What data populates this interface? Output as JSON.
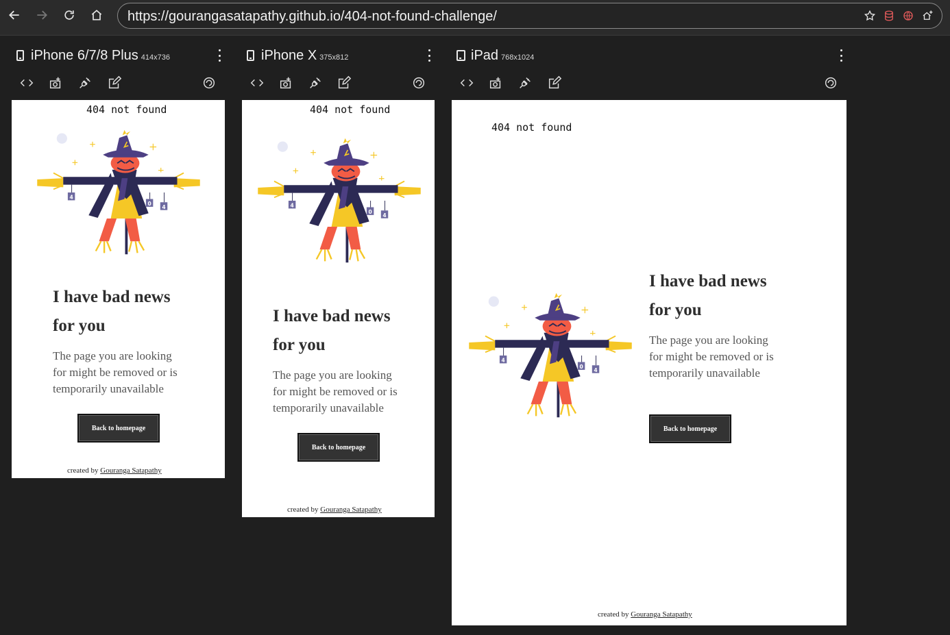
{
  "browser": {
    "url": "https://gourangasatapathy.github.io/404-not-found-challenge/",
    "back_icon": "arrow-left-icon",
    "forward_icon": "arrow-right-icon",
    "reload_icon": "reload-icon",
    "home_icon": "home-icon",
    "bookmark_icon": "star-icon"
  },
  "devices": [
    {
      "name": "iPhone 6/7/8 Plus",
      "resolution": "414x736"
    },
    {
      "name": "iPhone X",
      "resolution": "375x812"
    },
    {
      "name": "iPad",
      "resolution": "768x1024"
    }
  ],
  "tool_icons": [
    "code-icon",
    "screenshot-icon",
    "plug-icon",
    "edit-icon",
    "rotate-icon"
  ],
  "page": {
    "header": "404 not found",
    "heading_line1": "I have bad news",
    "heading_line2": "for you",
    "body_line1": "The page you are looking",
    "body_line2": "for might be removed or is",
    "body_line3": "temporarily unavailable",
    "button_label": "Back to homepage",
    "credit_prefix": "created by",
    "credit_author": "Gouranga Satapathy",
    "sign_left": "4",
    "sign_mid": "0",
    "sign_right": "4"
  },
  "colors": {
    "browser_bg": "#1f1f1f",
    "hat": "#4d3f83",
    "coat": "#2c2a54",
    "face": "#f25c45",
    "straw": "#f5c726",
    "button_bg": "#333333"
  }
}
